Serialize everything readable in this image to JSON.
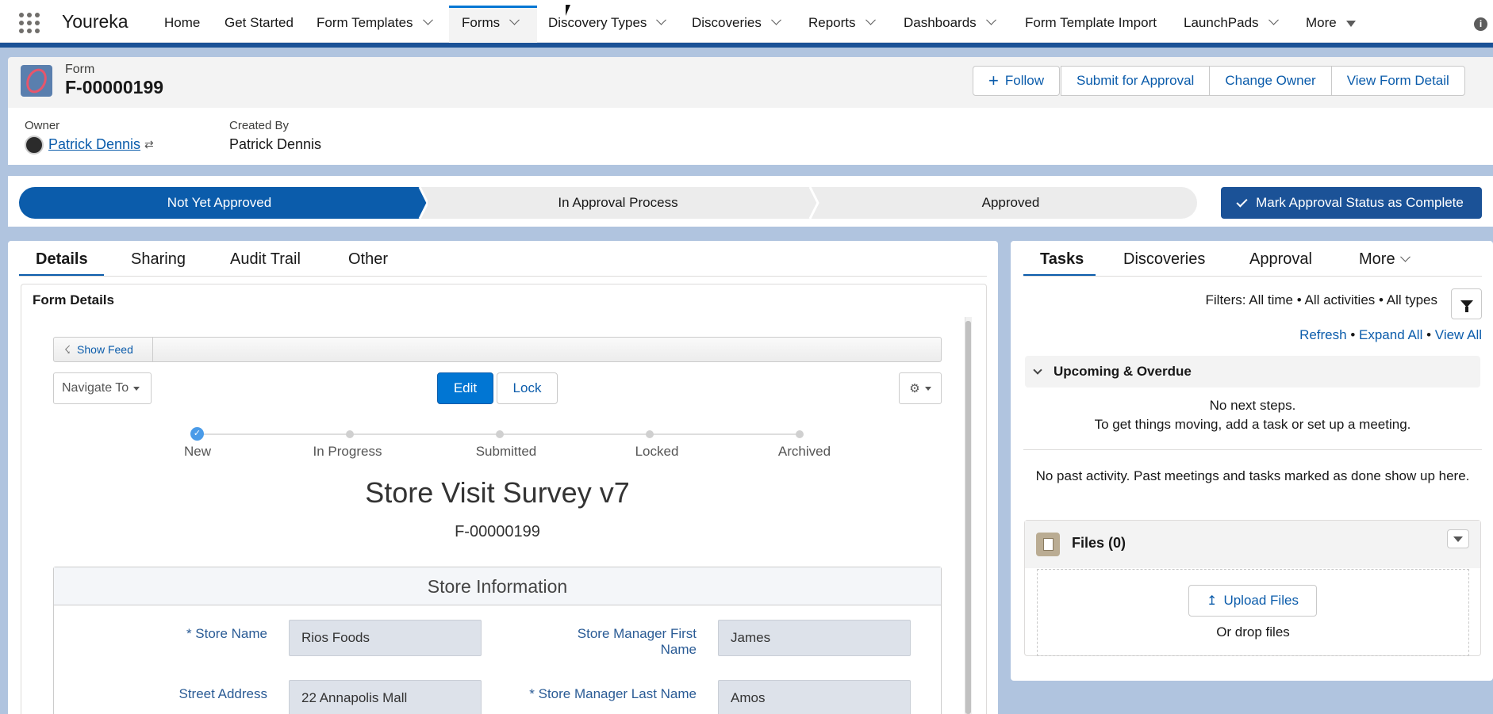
{
  "app": {
    "name": "Youreka"
  },
  "nav": {
    "items": [
      "Home",
      "Get Started",
      "Form Templates",
      "Forms",
      "Discovery Types",
      "Discoveries",
      "Reports",
      "Dashboards",
      "Form Template Import",
      "LaunchPads",
      "More"
    ],
    "active": "Forms"
  },
  "record": {
    "object_label": "Form",
    "name": "F-00000199",
    "owner_label": "Owner",
    "owner_value": "Patrick Dennis",
    "created_by_label": "Created By",
    "created_by_value": "Patrick Dennis"
  },
  "actions": {
    "follow": "Follow",
    "submit": "Submit for Approval",
    "change_owner": "Change Owner",
    "view_detail": "View Form Detail"
  },
  "path": {
    "stages": [
      "Not Yet Approved",
      "In Approval Process",
      "Approved"
    ],
    "active_stage": "Not Yet Approved",
    "mark_complete": "Mark Approval Status as Complete"
  },
  "left_tabs": [
    "Details",
    "Sharing",
    "Audit Trail",
    "Other"
  ],
  "left_active_tab": "Details",
  "form_details": {
    "title": "Form Details",
    "show_feed": "Show Feed",
    "navigate_to": "Navigate To",
    "edit": "Edit",
    "lock": "Lock",
    "progress": [
      "New",
      "In Progress",
      "Submitted",
      "Locked",
      "Archived"
    ],
    "progress_current": "New",
    "form_title": "Store Visit Survey v7",
    "form_number": "F-00000199",
    "section_title": "Store Information",
    "fields": [
      {
        "label": "* Store Name",
        "value": "Rios Foods"
      },
      {
        "label": "Store Manager First Name",
        "value": "James"
      },
      {
        "label": "Street Address",
        "value": "22 Annapolis Mall"
      },
      {
        "label": "* Store Manager Last Name",
        "value": "Amos"
      }
    ]
  },
  "right_tabs": [
    "Tasks",
    "Discoveries",
    "Approval",
    "More"
  ],
  "right_active_tab": "Tasks",
  "activity": {
    "filters": "Filters: All time • All activities • All types",
    "refresh": "Refresh",
    "expand_all": "Expand All",
    "view_all": "View All",
    "dot": "•",
    "upcoming": "Upcoming & Overdue",
    "no_next": "No next steps.",
    "no_next_hint": "To get things moving, add a task or set up a meeting.",
    "no_past": "No past activity. Past meetings and tasks marked as done show up here."
  },
  "files": {
    "title": "Files (0)",
    "upload": "Upload Files",
    "drop": "Or drop files"
  },
  "colors": {
    "brand": "#1b5297",
    "accent": "#0176d3",
    "link": "#0b5cab"
  }
}
